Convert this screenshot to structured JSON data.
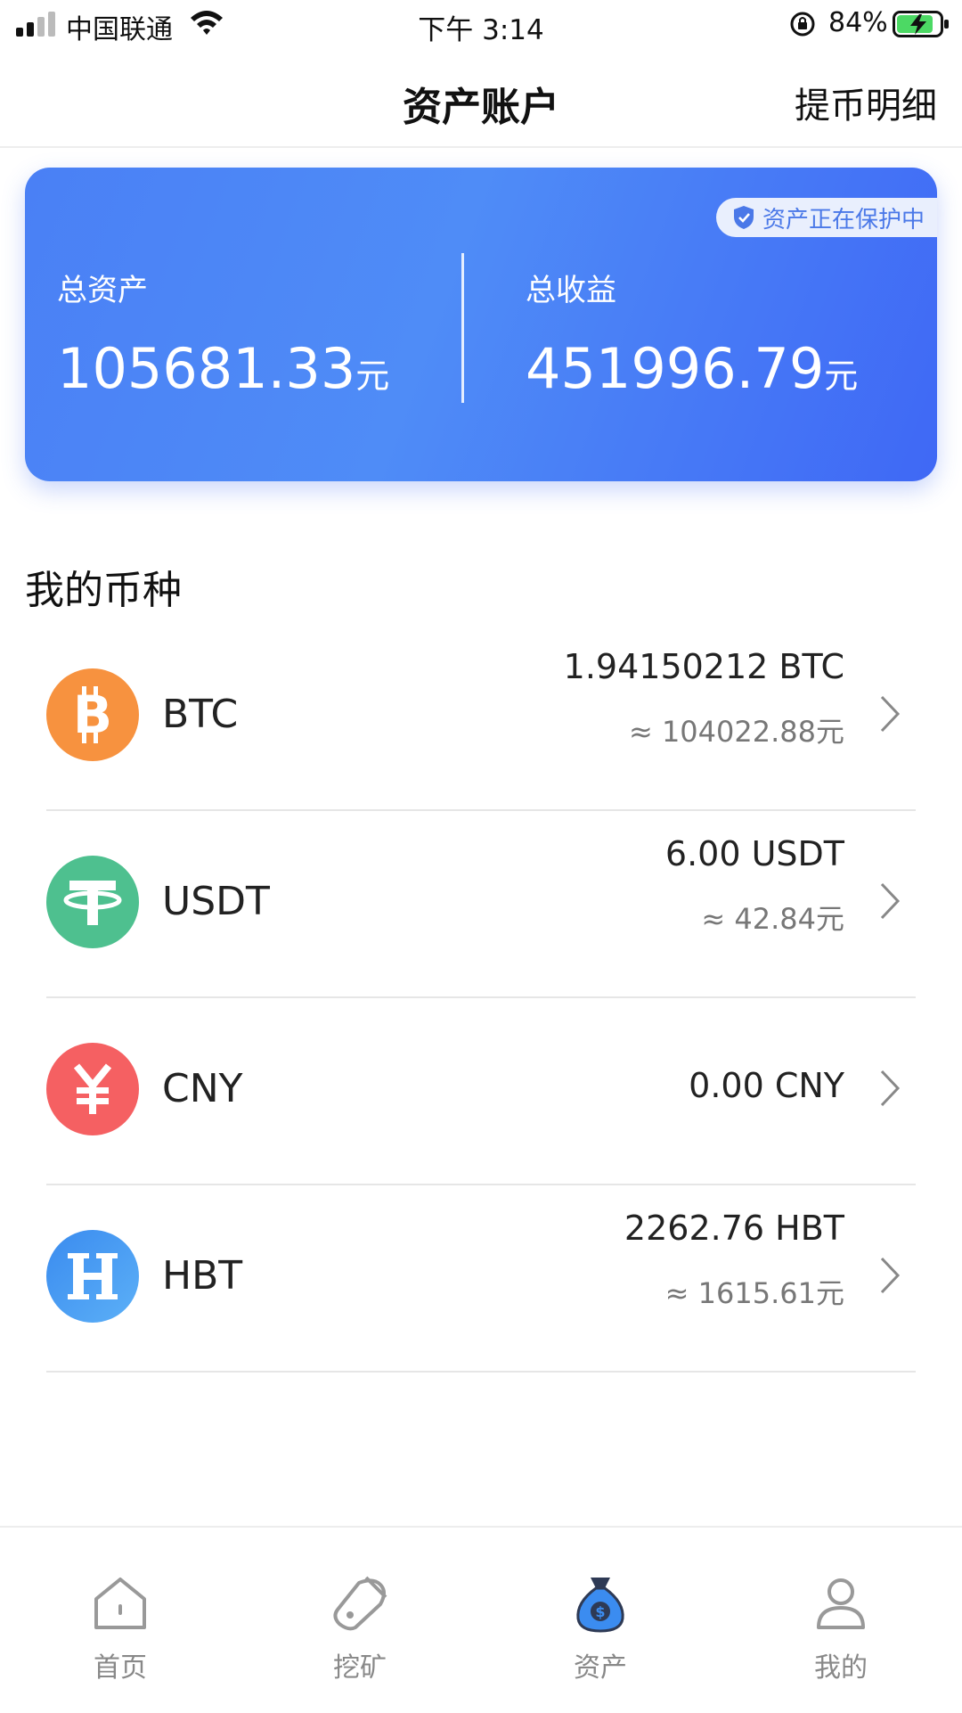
{
  "status_bar": {
    "carrier": "中国联通",
    "time": "下午 3:14",
    "battery": "84%"
  },
  "nav": {
    "title": "资产账户",
    "action": "提币明细"
  },
  "asset_card": {
    "badge": "资产正在保护中",
    "total_assets_label": "总资产",
    "total_assets_value": "105681.33",
    "total_assets_unit": "元",
    "total_income_label": "总收益",
    "total_income_value": "451996.79",
    "total_income_unit": "元",
    "colors": {
      "start": "#4a80f5",
      "end": "#3f68f5"
    }
  },
  "section": {
    "title": "我的币种"
  },
  "coins": [
    {
      "name": "BTC",
      "icon": "bitcoin-icon",
      "amount": "1.94150212 BTC",
      "cny": "≈ 104022.88元",
      "color": "#f7923f"
    },
    {
      "name": "USDT",
      "icon": "tether-icon",
      "amount": "6.00 USDT",
      "cny": "≈ 42.84元",
      "color": "#4ec08f"
    },
    {
      "name": "CNY",
      "icon": "yuan-icon",
      "amount": "0.00 CNY",
      "cny": "",
      "color": "#f56062"
    },
    {
      "name": "HBT",
      "icon": "hbt-icon",
      "amount": "2262.76 HBT",
      "cny": "≈ 1615.61元",
      "color": "#3f95f0"
    }
  ],
  "tabs": [
    {
      "label": "首页",
      "icon": "home-icon"
    },
    {
      "label": "挖矿",
      "icon": "mining-icon"
    },
    {
      "label": "资产",
      "icon": "money-bag-icon",
      "active": true
    },
    {
      "label": "我的",
      "icon": "user-icon"
    }
  ]
}
